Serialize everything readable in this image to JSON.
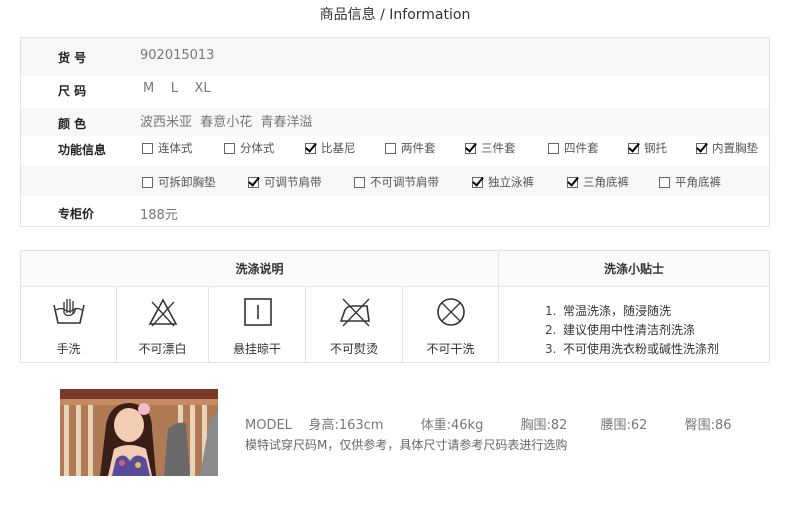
{
  "header": {
    "title": "商品信息 / Information"
  },
  "product": {
    "item_no_label": "货 号",
    "item_no": "902015013",
    "size_label": "尺 码",
    "sizes": "M    L    XL",
    "color_label": "颜 色",
    "colors": "波西米亚  春意小花  青春洋溢",
    "function_label": "功能信息",
    "price_label": "专柜价",
    "price": "188元"
  },
  "features": [
    {
      "label": "连体式",
      "checked": false
    },
    {
      "label": "分体式",
      "checked": false
    },
    {
      "label": "比基尼",
      "checked": true
    },
    {
      "label": "两件套",
      "checked": false
    },
    {
      "label": "三件套",
      "checked": true
    },
    {
      "label": "四件套",
      "checked": false
    },
    {
      "label": "钢托",
      "checked": true
    },
    {
      "label": "内置胸垫",
      "checked": true
    },
    {
      "label": "可拆卸胸垫",
      "checked": false
    },
    {
      "label": "可调节肩带",
      "checked": true
    },
    {
      "label": "不可调节肩带",
      "checked": false
    },
    {
      "label": "独立泳裤",
      "checked": true
    },
    {
      "label": "三角底裤",
      "checked": true
    },
    {
      "label": "平角底裤",
      "checked": false
    }
  ],
  "washing": {
    "heading": "洗涤说明",
    "tips_heading": "洗涤小贴士",
    "items": [
      {
        "label": "手洗",
        "icon": "hand-wash-icon"
      },
      {
        "label": "不可漂白",
        "icon": "no-bleach-icon"
      },
      {
        "label": "悬挂晾干",
        "icon": "hang-dry-icon"
      },
      {
        "label": "不可熨烫",
        "icon": "no-iron-icon"
      },
      {
        "label": "不可干洗",
        "icon": "no-dry-clean-icon"
      }
    ],
    "tips": [
      {
        "num": "1.",
        "text": "常温洗涤，随浸随洗"
      },
      {
        "num": "2.",
        "text": "建议使用中性清洁剂洗涤"
      },
      {
        "num": "3.",
        "text": "不可使用洗衣粉或碱性洗涤剂"
      }
    ]
  },
  "model": {
    "info": "MODEL    身高:163cm         体重:46kg         胸围:82        腰围:62         臀围:86",
    "note": "模特试穿尺码M，仅供参考，具体尺寸请参考尺码表进行选购"
  }
}
